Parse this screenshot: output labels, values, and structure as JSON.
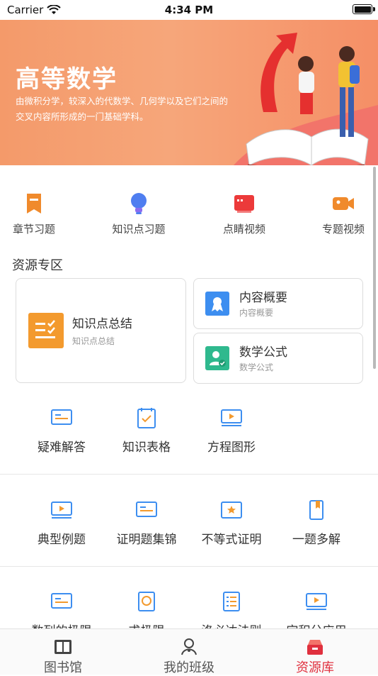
{
  "status_bar": {
    "carrier": "Carrier",
    "time": "4:34 PM"
  },
  "banner": {
    "title": "高等数学",
    "description": "由微积分学，较深入的代数学、几何学以及它们之间的交叉内容所形成的一门基础学科。"
  },
  "quick_links": [
    {
      "label": "章节习题",
      "icon": "bookmark-icon",
      "color": "#f08a2c"
    },
    {
      "label": "知识点习题",
      "icon": "lightbulb-icon",
      "color": "#4f7ef0"
    },
    {
      "label": "点睛视频",
      "icon": "book-icon",
      "color": "#ec3a3a"
    },
    {
      "label": "专题视频",
      "icon": "video-camera-icon",
      "color": "#f08a2c"
    }
  ],
  "resources": {
    "section_title": "资源专区",
    "big_card": {
      "title": "知识点总结",
      "subtitle": "知识点总结"
    },
    "small_cards": [
      {
        "title": "内容概要",
        "subtitle": "内容概要"
      },
      {
        "title": "数学公式",
        "subtitle": "数学公式"
      }
    ]
  },
  "grid_rows": [
    [
      "疑难解答",
      "知识表格",
      "方程图形"
    ],
    [
      "典型例题",
      "证明题集锦",
      "不等式证明",
      "一题多解"
    ],
    [
      "数列的极限",
      "求极限",
      "洛必达法则",
      "定积分应用"
    ]
  ],
  "accent_color": "#e0303e",
  "tab_bar": [
    {
      "label": "图书馆",
      "icon": "library-icon"
    },
    {
      "label": "我的班级",
      "icon": "class-icon"
    },
    {
      "label": "资源库",
      "icon": "resource-box-icon",
      "active": true
    }
  ]
}
